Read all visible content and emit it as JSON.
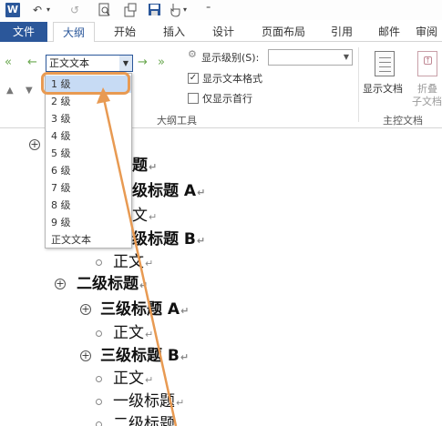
{
  "quick_access": {
    "app_badge": "W",
    "undo_glyph": "↶",
    "repeat_glyph": "↺",
    "customize_glyph": "⁼"
  },
  "tabs": [
    {
      "label": "文件"
    },
    {
      "label": "大纲"
    },
    {
      "label": "开始"
    },
    {
      "label": "插入"
    },
    {
      "label": "设计"
    },
    {
      "label": "页面布局"
    },
    {
      "label": "引用"
    },
    {
      "label": "邮件"
    },
    {
      "label": "审阅"
    }
  ],
  "ribbon": {
    "level_select_value": "正文文本",
    "show_level_label": "显示级别(S):",
    "show_level_value": "",
    "show_text_format_label": "显示文本格式",
    "show_text_format_checked": true,
    "first_line_only_label": "仅显示首行",
    "first_line_only_checked": false,
    "outline_tools_label": "大纲工具",
    "show_document_label": "显示文档",
    "collapse_label_1": "折叠",
    "collapse_label_2": "子文档",
    "master_document_label": "主控文档"
  },
  "dropdown": {
    "options": [
      "1 级",
      "2 级",
      "3 级",
      "4 级",
      "5 级",
      "6 级",
      "7 级",
      "8 级",
      "9 级",
      "正文文本"
    ],
    "selected_index": 0
  },
  "outline": {
    "l1_partial": "题",
    "l2_partial_a": "级标题 A",
    "body_partial": "文",
    "l2_partial_b": "级标题 B",
    "body_1": "正文",
    "heading_2": "二级标题",
    "heading_3a": "三级标题 A",
    "body_2": "正文",
    "heading_3b": "三级标题 B",
    "body_3": "正文",
    "body_4": "一级标题",
    "body_5": "二级标题"
  },
  "colors": {
    "accent": "#2b579a",
    "annotation": "#e89a52",
    "selected": "#c7dbf4"
  }
}
